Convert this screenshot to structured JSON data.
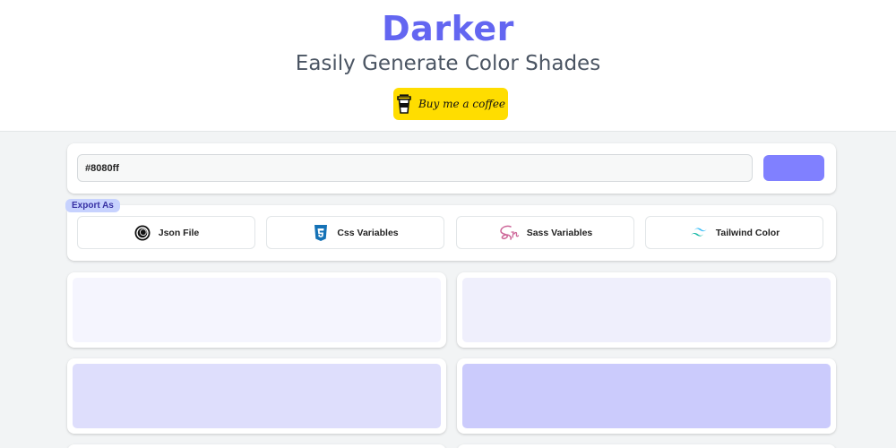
{
  "header": {
    "title": "Darker",
    "subtitle": "Easily Generate Color Shades",
    "coffee_button_label": "Buy me a coffee",
    "coffee_icon": "coffee-cup-icon",
    "title_color": "#6366f1",
    "coffee_bg_color": "#ffdd00"
  },
  "color_input": {
    "value": "#8080ff",
    "swatch_color": "#8080ff"
  },
  "export": {
    "badge_label": "Export As",
    "buttons": [
      {
        "label": "Json File",
        "icon": "json-icon"
      },
      {
        "label": "Css Variables",
        "icon": "css3-icon"
      },
      {
        "label": "Sass Variables",
        "icon": "sass-icon"
      },
      {
        "label": "Tailwind Color",
        "icon": "tailwind-icon"
      }
    ]
  },
  "shades": [
    {
      "color": "#f5f5fe"
    },
    {
      "color": "#efeffc"
    },
    {
      "color": "#dedefc"
    },
    {
      "color": "#cbcbfc"
    }
  ]
}
